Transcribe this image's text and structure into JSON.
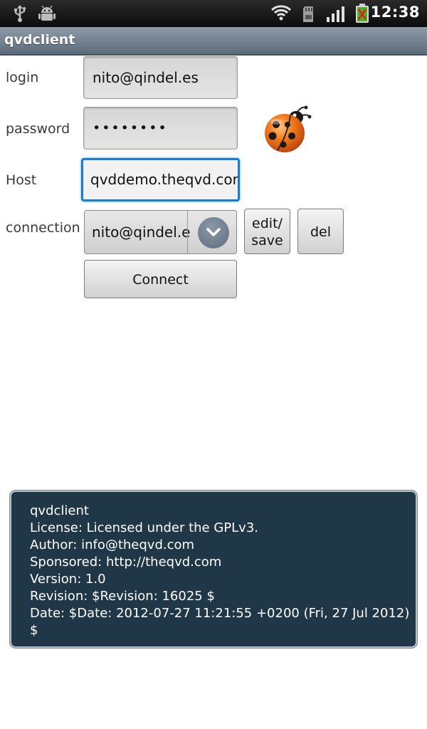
{
  "status_bar": {
    "time": "12:38",
    "left_icons": [
      "usb-icon",
      "android-debug-icon"
    ],
    "right_icons": [
      "wifi-icon",
      "sd-card-icon",
      "signal-icon",
      "battery-icon"
    ]
  },
  "app": {
    "title": "qvdclient"
  },
  "form": {
    "login_label": "login",
    "login_value": "nito@qindel.es",
    "password_label": "password",
    "password_value": "••••••••",
    "host_label": "Host",
    "host_value": "qvddemo.theqvd.com",
    "connection_label": "connection",
    "connection_selected": "nito@qindel.es"
  },
  "buttons": {
    "edit_line1": "edit/",
    "edit_line2": "save",
    "del": "del",
    "connect": "Connect"
  },
  "about": {
    "lines": [
      "qvdclient",
      "License: Licensed under the GPLv3.",
      "Author: info@theqvd.com",
      "Sponsored: http://theqvd.com",
      "Version: 1.0",
      "Revision: $Revision: 16025 $",
      "Date: $Date: 2012-07-27 11:21:55 +0200 (Fri, 27 Jul 2012)",
      "$"
    ]
  },
  "colors": {
    "title_bar": "#6f7e8d",
    "focus_border": "#1b7cc7",
    "about_background": "#1f3747"
  }
}
